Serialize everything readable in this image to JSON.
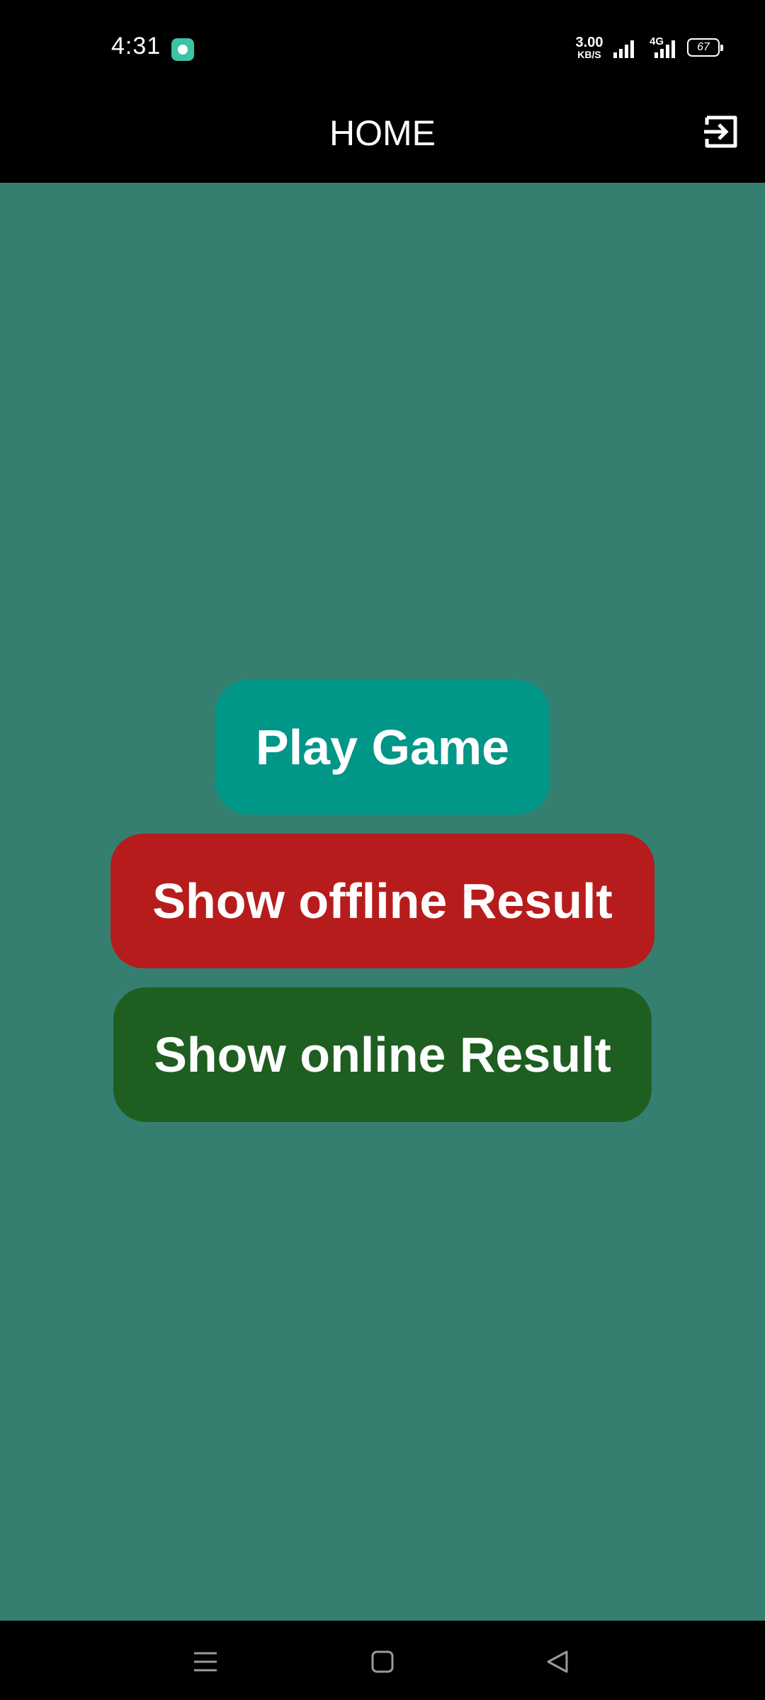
{
  "status_bar": {
    "time": "4:31",
    "app_icon": "app-notification-icon",
    "net_speed_value": "3.00",
    "net_speed_unit": "KB/S",
    "network_type": "4G",
    "battery_level": "67"
  },
  "app_bar": {
    "title": "HOME",
    "logout_icon": "logout-icon"
  },
  "main": {
    "background_color": "#357f70",
    "buttons": [
      {
        "label": "Play Game",
        "color": "#009688"
      },
      {
        "label": "Show offline Result",
        "color": "#b71c1c"
      },
      {
        "label": "Show online Result",
        "color": "#1e5e21"
      }
    ]
  },
  "nav_bar": {
    "icons": [
      "menu-icon",
      "home-icon",
      "back-icon"
    ]
  }
}
